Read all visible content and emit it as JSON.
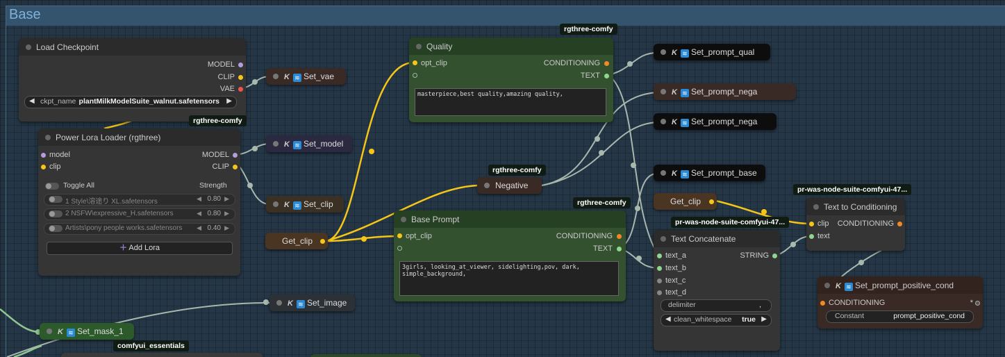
{
  "group": {
    "title": "Base"
  },
  "colors": {
    "clip_wire": "#f5c518",
    "green_wire": "#8fc591",
    "grey_wire": "#a9b8ad",
    "group_title": "#7fb1d9"
  },
  "badges": {
    "rgthree_1": "rgthree-comfy",
    "rgthree_2": "rgthree-comfy",
    "rgthree_3": "rgthree-comfy",
    "rgthree_4": "rgthree-comfy",
    "was_1": "pr-was-node-suite-comfyui-47...",
    "was_2": "pr-was-node-suite-comfyui-47...",
    "essentials": "comfyui_essentials"
  },
  "load_checkpoint": {
    "title": "Load Checkpoint",
    "outputs": [
      "MODEL",
      "CLIP",
      "VAE"
    ],
    "ckpt_label": "ckpt_name",
    "ckpt_value": "plantMilkModelSuite_walnut.safetensors"
  },
  "power_lora": {
    "title": "Power Lora Loader (rgthree)",
    "inputs": [
      "model",
      "clip"
    ],
    "outputs": [
      "MODEL",
      "CLIP"
    ],
    "toggle_all": "Toggle All",
    "strength": "Strength",
    "loras": [
      {
        "name": "1 Style\\溶途り XL.safetensors",
        "value": "0.80"
      },
      {
        "name": "2 NSFW\\expressive_H.safetensors",
        "value": "0.80"
      },
      {
        "name": "Artists\\pony people works.safetensors",
        "value": "0.40"
      }
    ],
    "add_lora": "Add Lora"
  },
  "set_nodes": {
    "set_vae": "Set_vae",
    "set_model": "Set_model",
    "set_clip": "Set_clip",
    "set_image": "Set_image",
    "set_mask": "Set_mask_1",
    "set_prompt_qual": "Set_prompt_qual",
    "set_prompt_nega_1": "Set_prompt_nega",
    "set_prompt_nega_2": "Set_prompt_nega",
    "set_prompt_base": "Set_prompt_base"
  },
  "get_clip_1": "Get_clip",
  "get_clip_2": "Get_clip",
  "quality": {
    "title": "Quality",
    "input": "opt_clip",
    "outputs": [
      "CONDITIONING",
      "TEXT"
    ],
    "text": "masterpiece,best quality,amazing quality,"
  },
  "negative": {
    "title": "Negative"
  },
  "base_prompt": {
    "title": "Base Prompt",
    "input": "opt_clip",
    "outputs": [
      "CONDITIONING",
      "TEXT"
    ],
    "text": "3girls, looking_at_viewer, sidelighting,pov, dark, simple_background,"
  },
  "text_concat": {
    "title": "Text Concatenate",
    "inputs": [
      "text_a",
      "text_b",
      "text_c",
      "text_d"
    ],
    "output": "STRING",
    "delimiter_label": "delimiter",
    "delimiter_value": ",",
    "clean_label": "clean_whitespace",
    "clean_value": "true"
  },
  "text_to_cond": {
    "title": "Text to Conditioning",
    "inputs": [
      "clip",
      "text"
    ],
    "output": "CONDITIONING"
  },
  "set_prompt_positive_cond": {
    "title": "Set_prompt_positive_cond",
    "input": "CONDITIONING",
    "star": "*",
    "constant_label": "Constant",
    "constant_value": "prompt_positive_cond"
  }
}
